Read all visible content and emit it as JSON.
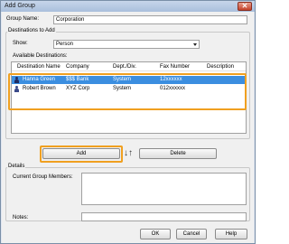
{
  "window": {
    "title": "Add Group",
    "close_glyph": "✕"
  },
  "group_name": {
    "label": "Group Name:",
    "value": "Corporation"
  },
  "destinations": {
    "group_label": "Destinations to Add",
    "show_label": "Show:",
    "show_value": "Person",
    "available_label": "Available Destinations:",
    "columns": [
      "Destination Name",
      "Company",
      "Dept./Div.",
      "Fax Number",
      "Description"
    ],
    "rows": [
      {
        "name": "Hanna Green",
        "company": "$$$ Bank",
        "dept": "System",
        "fax": "12xxxxxx",
        "description": "",
        "selected": true
      },
      {
        "name": "Robert Brown",
        "company": "XYZ Corp",
        "dept": "System",
        "fax": "012xxxxxx",
        "description": "",
        "selected": false
      }
    ]
  },
  "buttons": {
    "add": "Add",
    "delete": "Delete",
    "ok": "OK",
    "cancel": "Cancel",
    "help": "Help"
  },
  "arrows_glyph": "↓↑",
  "details": {
    "group_label": "Details",
    "members_label": "Current Group Members:",
    "notes_label": "Notes:"
  },
  "colors": {
    "highlight": "#f0a020",
    "selection": "#3b8ee0"
  }
}
